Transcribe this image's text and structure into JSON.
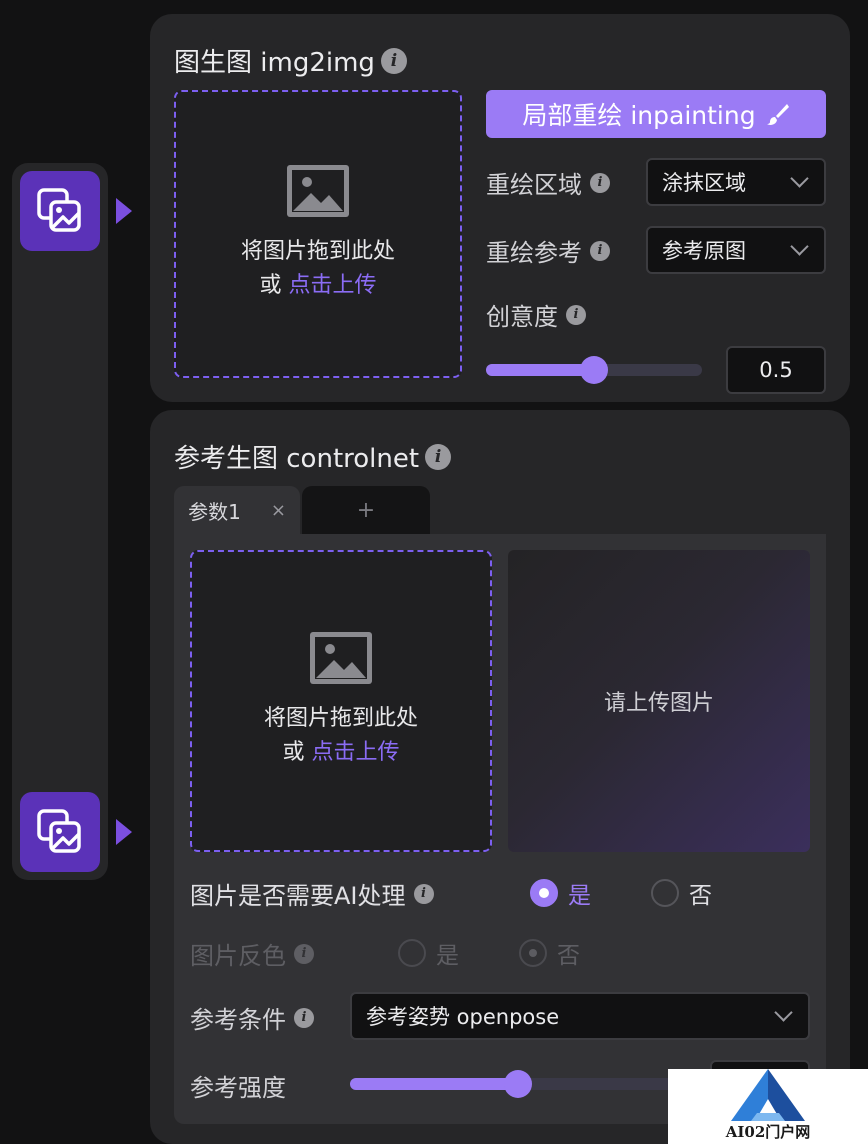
{
  "rail": {
    "items": [
      {
        "icon": "image-stack-icon"
      },
      {
        "icon": "image-stack-icon"
      }
    ]
  },
  "img2img": {
    "title": "图生图 img2img",
    "info_icon": "info-icon",
    "dropzone": {
      "icon": "image-placeholder-icon",
      "text": "将图片拖到此处",
      "or": "或",
      "upload_link": "点击上传"
    },
    "inpaint_button": {
      "label": "局部重绘 inpainting",
      "icon": "brush-icon"
    },
    "repaint_area": {
      "label": "重绘区域",
      "value": "涂抹区域"
    },
    "repaint_ref": {
      "label": "重绘参考",
      "value": "参考原图"
    },
    "creativity": {
      "label": "创意度",
      "value": "0.5",
      "level": 0.5
    }
  },
  "controlnet": {
    "title": "参考生图 controlnet",
    "tabs": [
      {
        "label": "参数1",
        "close": "×"
      },
      {
        "label": "+"
      }
    ],
    "dropzone": {
      "icon": "image-placeholder-icon",
      "text": "将图片拖到此处",
      "or": "或",
      "upload_link": "点击上传"
    },
    "preview_text": "请上传图片",
    "ai_process": {
      "label": "图片是否需要AI处理",
      "yes": "是",
      "no": "否",
      "selected": "是"
    },
    "invert": {
      "label": "图片反色",
      "yes": "是",
      "no": "否",
      "selected": "否",
      "disabled": true
    },
    "condition": {
      "label": "参考条件",
      "value": "参考姿势 openpose"
    },
    "strength": {
      "label": "参考强度",
      "level": 0.5
    }
  },
  "watermark": {
    "text": "AI02门户网"
  },
  "colors": {
    "accent": "#9b7bf5",
    "rail_button": "#5b32b8",
    "card": "#262628",
    "background": "#121213"
  }
}
